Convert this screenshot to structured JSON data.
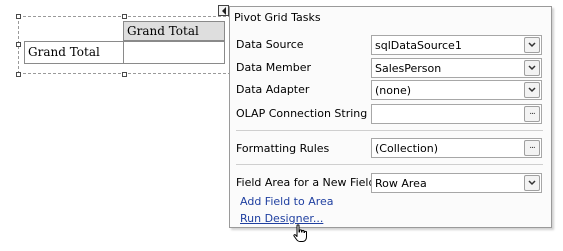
{
  "pivot_grid": {
    "column_header": "Grand Total",
    "row_header": "Grand Total"
  },
  "tasks_panel": {
    "title": "Pivot Grid Tasks",
    "rows": [
      {
        "label": "Data Source",
        "value": "sqlDataSource1",
        "control": "dropdown"
      },
      {
        "label": "Data Member",
        "value": "SalesPerson",
        "control": "dropdown"
      },
      {
        "label": "Data Adapter",
        "value": "(none)",
        "control": "dropdown"
      },
      {
        "label": "OLAP Connection String",
        "value": "",
        "control": "ellipsis"
      },
      {
        "label": "Formatting Rules",
        "value": "(Collection)",
        "control": "ellipsis"
      },
      {
        "label": "Field Area for a New Field",
        "value": "Row Area",
        "control": "dropdown"
      }
    ],
    "ellipsis_glyph": "...",
    "links": {
      "add_field": "Add Field to Area",
      "run_designer": "Run Designer..."
    }
  },
  "colors": {
    "link": "#1f3fa0",
    "header_cell": "#dedede"
  },
  "icons": {
    "smart_tag": "smart-tag-arrow-icon",
    "dropdown": "chevron-down-icon",
    "ellipsis": "ellipsis-icon",
    "cursor": "hand-pointer-icon"
  }
}
